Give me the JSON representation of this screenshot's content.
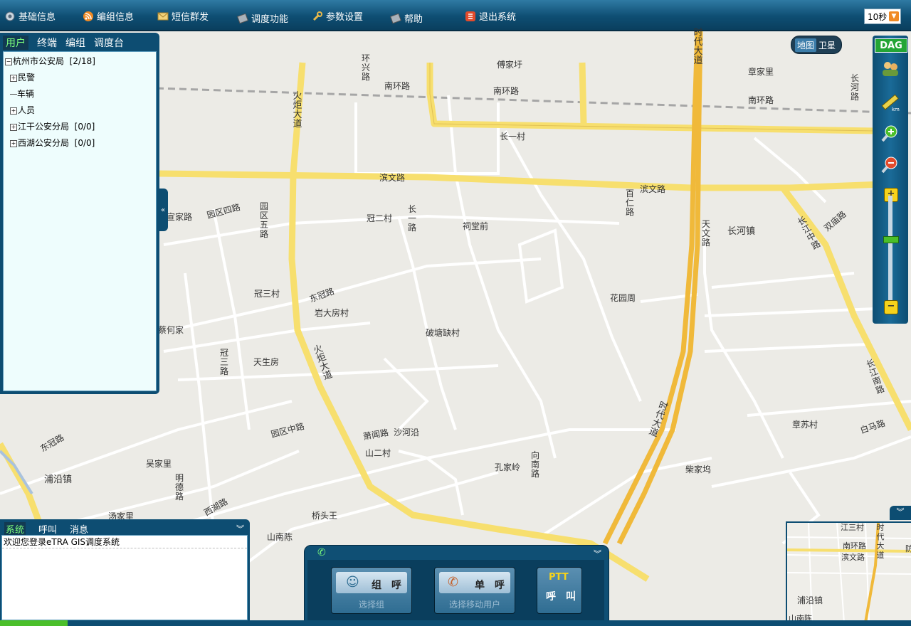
{
  "toolbar": {
    "items": [
      {
        "label": "基础信息",
        "icon": "gear-icon"
      },
      {
        "label": "编组信息",
        "icon": "rss-icon"
      },
      {
        "label": "短信群发",
        "icon": "mail-icon"
      },
      {
        "label": "调度功能",
        "icon": "dispatch-icon"
      },
      {
        "label": "参数设置",
        "icon": "wrench-icon"
      },
      {
        "label": "帮助",
        "icon": "help-icon"
      },
      {
        "label": "退出系统",
        "icon": "exit-icon"
      }
    ],
    "refresh_interval": "10秒"
  },
  "map_type": {
    "map": "地图",
    "satellite": "卫星",
    "selected": "地图"
  },
  "tools": {
    "logo": "DAG"
  },
  "left_panel": {
    "tabs": [
      "用户",
      "终端",
      "编组",
      "调度台"
    ],
    "active_tab": "用户",
    "tree": {
      "root": "杭州市公安局",
      "root_count": "[2/18]",
      "children": [
        {
          "label": "民警",
          "count": ""
        },
        {
          "label": "车辆",
          "count": ""
        },
        {
          "label": "人员",
          "count": ""
        },
        {
          "label": "江干公安分局",
          "count": "[0/0]"
        },
        {
          "label": "西湖公安分局",
          "count": "[0/0]"
        }
      ]
    }
  },
  "message_panel": {
    "tabs": [
      "系统",
      "呼叫",
      "消息"
    ],
    "active_tab": "系统",
    "messages": [
      "欢迎您登录eTRA GIS调度系统"
    ]
  },
  "call_panel": {
    "buttons": [
      {
        "label": "组　呼",
        "sub": "选择组"
      },
      {
        "label": "单　呼",
        "sub": "选择移动用户"
      },
      {
        "label": "呼　叫",
        "sub": "",
        "badge": "PTT"
      }
    ]
  },
  "map_labels": {
    "places": [
      "傅家圩",
      "章家里",
      "长一村",
      "冠二村",
      "祠堂前",
      "长河镇",
      "冠三村",
      "岩大房村",
      "花园周",
      "破塘缺村",
      "蔡何家",
      "天生房",
      "章苏村",
      "沙河沿",
      "山二村",
      "孔家岭",
      "柴家坞",
      "吴家里",
      "浦沿镇",
      "汤家里",
      "桥头王",
      "山南陈",
      "宣家路"
    ],
    "roads": [
      "南环路",
      "南环路",
      "南环路",
      "滨文路",
      "滨文路",
      "东冠路",
      "园区四路",
      "园区中路",
      "白马路",
      "东冠路",
      "萧闻路",
      "西湖路",
      "双庙路"
    ],
    "vertical_roads": [
      "环兴路",
      "火炬大道",
      "火炬大道",
      "时代大道",
      "时代大道",
      "长河路",
      "百仁路",
      "天文路",
      "长江中路",
      "长江南路",
      "长一路",
      "园区五路",
      "冠三路",
      "明德路",
      "向南路"
    ]
  },
  "overview_labels": [
    "江三村",
    "南环路",
    "滨文路",
    "时代大道",
    "浦沿镇",
    "山南陈",
    "防"
  ]
}
